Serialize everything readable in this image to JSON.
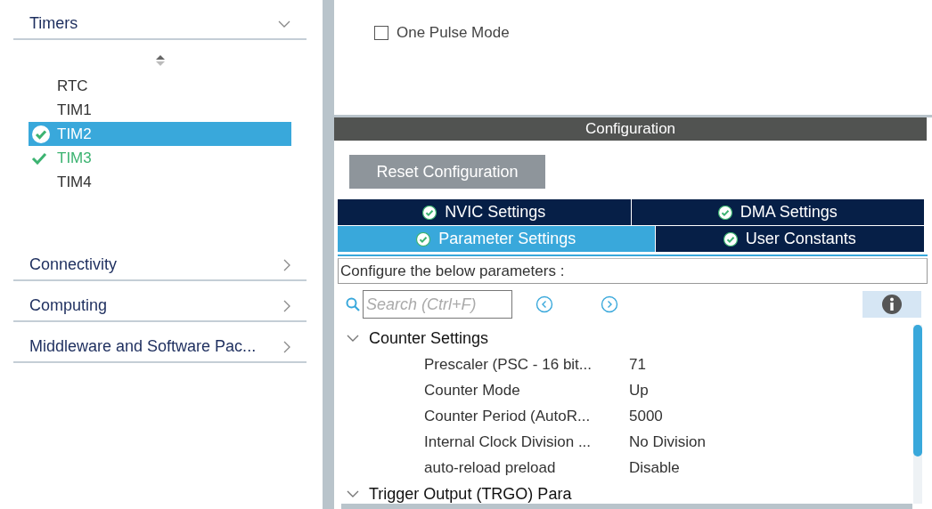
{
  "sidebar": {
    "sections": [
      {
        "label": "Timers",
        "expanded": true,
        "items": [
          {
            "label": "RTC",
            "selected": false,
            "checked": false
          },
          {
            "label": "TIM1",
            "selected": false,
            "checked": false
          },
          {
            "label": "TIM2",
            "selected": true,
            "checked": true
          },
          {
            "label": "TIM3",
            "selected": false,
            "checked": true
          },
          {
            "label": "TIM4",
            "selected": false,
            "checked": false
          }
        ]
      },
      {
        "label": "Connectivity",
        "expanded": false
      },
      {
        "label": "Computing",
        "expanded": false
      },
      {
        "label": "Middleware and Software Pac...",
        "expanded": false
      }
    ]
  },
  "mode": {
    "options": [
      {
        "label": "One Pulse Mode",
        "checked": false,
        "disabled": false
      }
    ]
  },
  "configuration": {
    "title": "Configuration",
    "reset_button": "Reset Configuration",
    "tab_rows": [
      [
        {
          "label": "NVIC Settings",
          "selected": false
        },
        {
          "label": "DMA Settings",
          "selected": false
        }
      ],
      [
        {
          "label": "Parameter Settings",
          "selected": true
        },
        {
          "label": "User Constants",
          "selected": false
        }
      ]
    ],
    "hint": "Configure the below parameters :",
    "search": {
      "placeholder": "Search (Ctrl+F)"
    },
    "groups": [
      {
        "label": "Counter Settings",
        "expanded": true,
        "children": [
          {
            "name": "Prescaler (PSC - 16 bit...",
            "value": "71"
          },
          {
            "name": "Counter Mode",
            "value": "Up"
          },
          {
            "name": "Counter Period (AutoR...",
            "value": "5000"
          },
          {
            "name": "Internal Clock Division ...",
            "value": "No Division"
          },
          {
            "name": "auto-reload preload",
            "value": "Disable"
          }
        ]
      },
      {
        "label": "Trigger Output (TRGO) Para",
        "expanded": true
      }
    ]
  }
}
